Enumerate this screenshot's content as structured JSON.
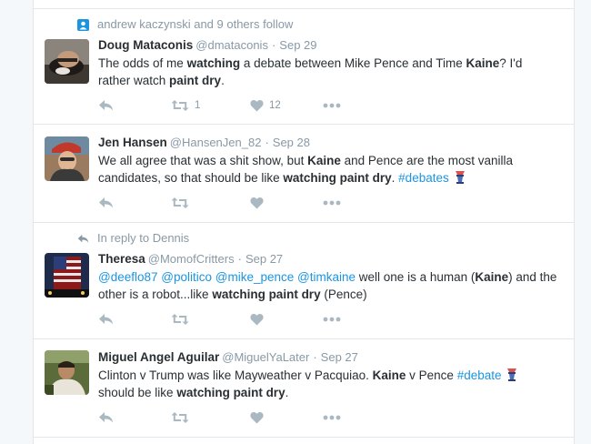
{
  "context_follow": "andrew kaczynski and 9 others follow",
  "tweets": [
    {
      "name": "Doug Mataconis",
      "handle": "@dmataconis",
      "sep": "·",
      "time": "Sep 29",
      "reply_context": "",
      "parts": [
        {
          "t": "The odds of me "
        },
        {
          "t": "watching",
          "b": true
        },
        {
          "t": " a debate between Mike Pence and Time "
        },
        {
          "t": "Kaine",
          "b": true
        },
        {
          "t": "? I'd rather watch "
        },
        {
          "t": "paint dry",
          "b": true
        },
        {
          "t": "."
        }
      ],
      "retweets": "1",
      "likes": "12"
    },
    {
      "name": "Jen Hansen",
      "handle": "@HansenJen_82",
      "sep": "·",
      "time": "Sep 28",
      "reply_context": "",
      "parts": [
        {
          "t": "We all agree that was a shit show, but "
        },
        {
          "t": "Kaine",
          "b": true
        },
        {
          "t": " and Pence are the most vanilla candidates, so that should be like "
        },
        {
          "t": "watching paint dry",
          "b": true
        },
        {
          "t": ". "
        },
        {
          "t": "#debates",
          "link": true
        },
        {
          "t": " "
        },
        {
          "t": "",
          "emoji": true
        }
      ],
      "retweets": "",
      "likes": ""
    },
    {
      "name": "Theresa",
      "handle": "@MomofCritters",
      "sep": "·",
      "time": "Sep 27",
      "reply_context": "In reply to Dennis",
      "parts": [
        {
          "t": "@deeflo87",
          "link": true
        },
        {
          "t": " "
        },
        {
          "t": "@politico",
          "link": true
        },
        {
          "t": " "
        },
        {
          "t": "@mike_pence",
          "link": true
        },
        {
          "t": " "
        },
        {
          "t": "@timkaine",
          "link": true
        },
        {
          "t": " well one is a human ("
        },
        {
          "t": "Kaine",
          "b": true
        },
        {
          "t": ") and the other is a robot...like "
        },
        {
          "t": "watching paint dry",
          "b": true
        },
        {
          "t": " (Pence)"
        }
      ],
      "retweets": "",
      "likes": ""
    },
    {
      "name": "Miguel Angel Aguilar",
      "handle": "@MiguelYaLater",
      "sep": "·",
      "time": "Sep 27",
      "reply_context": "",
      "parts": [
        {
          "t": "Clinton v Trump was like Mayweather v Pacquiao.  "
        },
        {
          "t": "Kaine",
          "b": true
        },
        {
          "t": " v Pence "
        },
        {
          "t": "#debate",
          "link": true
        },
        {
          "t": " "
        },
        {
          "t": "",
          "emoji": true
        },
        {
          "t": " should be like "
        },
        {
          "t": "watching paint dry",
          "b": true
        },
        {
          "t": "."
        }
      ],
      "retweets": "",
      "likes": ""
    }
  ],
  "icons": {
    "reply": "reply-icon",
    "retweet": "retweet-icon",
    "like": "heart-icon",
    "more": "more-icon",
    "follow": "person-icon",
    "reply_context": "reply-arrow-icon"
  },
  "colors": {
    "link": "#1b95e0",
    "secondary": "#8899a6",
    "action": "#aab8c2",
    "border": "#e1e8ed"
  }
}
